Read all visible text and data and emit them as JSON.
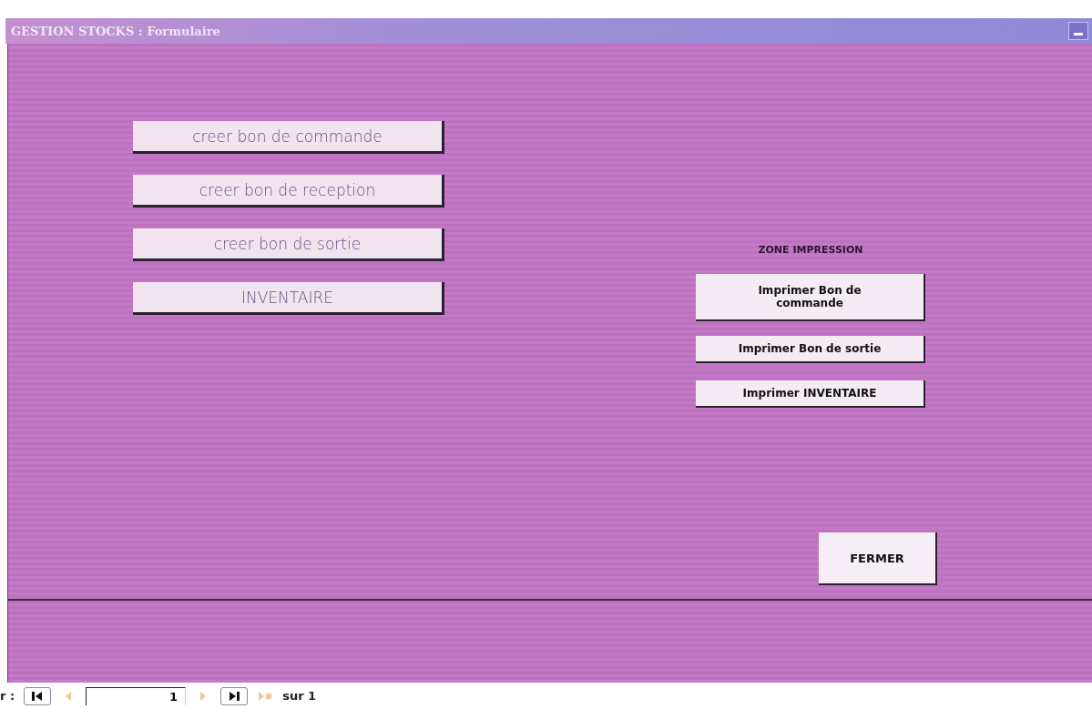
{
  "window": {
    "title": "GESTION STOCKS : Formulaire"
  },
  "actions": [
    "creer bon de commande",
    "creer bon de reception",
    "creer bon de sortie",
    "INVENTAIRE"
  ],
  "print_zone": {
    "heading": "ZONE IMPRESSION",
    "buttons": [
      "Imprimer Bon de commande",
      "Imprimer Bon de sortie",
      "Imprimer INVENTAIRE"
    ]
  },
  "close_button": "FERMER",
  "record_nav": {
    "label": "r :",
    "record": "1",
    "total": "sur 1",
    "buttons": [
      {
        "kind": "first",
        "disabled": false
      },
      {
        "kind": "prev",
        "disabled": true
      },
      {
        "kind": "field"
      },
      {
        "kind": "next",
        "disabled": true
      },
      {
        "kind": "last",
        "disabled": false
      },
      {
        "kind": "new",
        "disabled": true
      }
    ]
  }
}
